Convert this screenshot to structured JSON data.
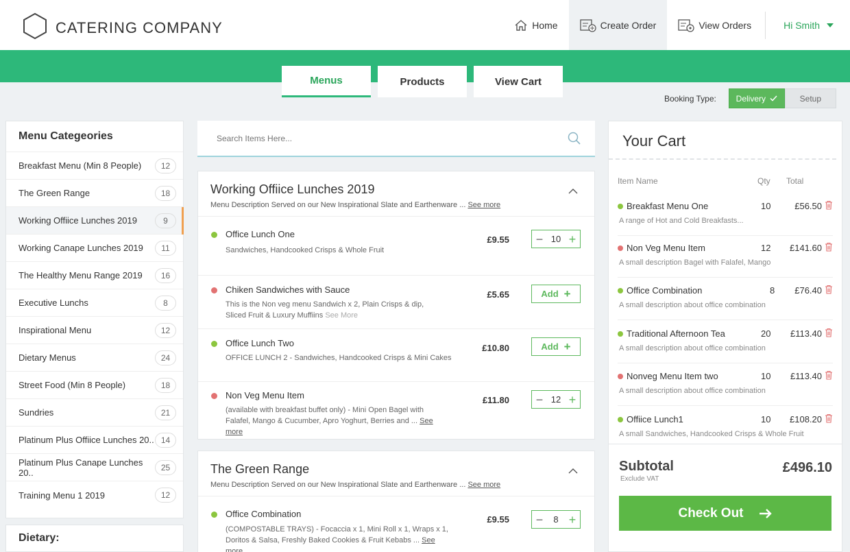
{
  "brand": {
    "name": "CATERING COMPANY"
  },
  "nav": {
    "home": "Home",
    "create_order": "Create Order",
    "view_orders": "View Orders",
    "user": "Hi Smith"
  },
  "tabs": [
    "Menus",
    "Products",
    "View Cart"
  ],
  "booking": {
    "label": "Booking Type:",
    "delivery": "Delivery",
    "setup": "Setup",
    "selected": "Delivery"
  },
  "sidebar": {
    "title": "Menu Categeories",
    "items": [
      {
        "label": "Breakfast Menu (Min 8 People)",
        "count": "12"
      },
      {
        "label": "The Green Range",
        "count": "18"
      },
      {
        "label": "Working Offiice Lunches 2019",
        "count": "9",
        "active": true
      },
      {
        "label": "Working Canape Lunches 2019",
        "count": "11"
      },
      {
        "label": "The Healthy Menu Range 2019",
        "count": "16"
      },
      {
        "label": "Executive Lunchs",
        "count": "8"
      },
      {
        "label": "Inspirational Menu",
        "count": "12"
      },
      {
        "label": "Dietary Menus",
        "count": "24"
      },
      {
        "label": "Street Food (Min 8 People)",
        "count": "18"
      },
      {
        "label": "Sundries",
        "count": "21"
      },
      {
        "label": "Platinum Plus Offiice Lunches 20..",
        "count": "14"
      },
      {
        "label": "Platinum Plus Canape Lunches 20..",
        "count": "25"
      },
      {
        "label": "Training Menu 1 2019",
        "count": "12"
      }
    ],
    "dietary_title": "Dietary:"
  },
  "search": {
    "placeholder": "Search Items Here..."
  },
  "sections": [
    {
      "title": "Working Offiice Lunches 2019",
      "desc": "Menu Description Served on our New Inspirational Slate and Earthenware",
      "see_more": "See more",
      "items": [
        {
          "name": "Office Lunch One",
          "desc1": "Sandwiches, Handcooked Crisps & Whole Fruit",
          "desc2": "",
          "inline_more": "",
          "price": "£9.55",
          "qty": "10",
          "type": "veg"
        },
        {
          "name": "Chiken Sandwiches with Sauce",
          "desc1": "This is the Non veg menu Sandwich x 2, Plain Crisps & dip,",
          "desc2": "Sliced Fruit & Luxury Muffiins",
          "inline_more": "See More",
          "price": "£5.65",
          "add": "Add",
          "type": "nonveg"
        },
        {
          "name": "Office Lunch Two",
          "desc1": "OFFICE LUNCH 2 - Sandwiches, Handcooked Crisps & Mini Cakes",
          "desc2": "",
          "inline_more": "",
          "price": "£10.80",
          "add": "Add",
          "type": "veg"
        },
        {
          "name": "Non Veg Menu Item",
          "desc1": "(available with breakfast buffet only) - Mini Open Bagel with",
          "desc2": "Falafel, Mango & Cucumber, Apro Yoghurt, Berries and ...",
          "inline_more": "See more",
          "price": "£11.80",
          "qty": "12",
          "type": "nonveg"
        }
      ]
    },
    {
      "title": "The Green Range",
      "desc": "Menu Description Served on our New Inspirational Slate and Earthenware",
      "see_more": "See more",
      "items": [
        {
          "name": "Office Combination",
          "desc1": "(COMPOSTABLE TRAYS) - Focaccia x 1, Mini Roll x 1, Wraps x 1,",
          "desc2": "Doritos & Salsa, Freshly Baked Cookies & Fruit Kebabs  ...",
          "inline_more": "See more",
          "price": "£9.55",
          "qty": "8",
          "type": "veg"
        }
      ]
    }
  ],
  "cart": {
    "title": "Your Cart",
    "col_name": "Item Name",
    "col_qty": "Qty",
    "col_total": "Total",
    "rows": [
      {
        "name": "Breakfast Menu One",
        "desc": "A range of Hot and Cold Breakfasts...",
        "qty": "10",
        "total": "£56.50",
        "type": "veg"
      },
      {
        "name": "Non Veg Menu Item",
        "desc": "A small description Bagel with Falafel, Mango",
        "qty": "12",
        "total": "£141.60",
        "type": "nonveg"
      },
      {
        "name": "Office Combination",
        "desc": "A small description about office combination",
        "qty": "8",
        "total": "£76.40",
        "type": "veg"
      },
      {
        "name": "Traditional Afternoon Tea",
        "desc": "A small description about office combination",
        "qty": "20",
        "total": "£113.40",
        "type": "veg"
      },
      {
        "name": "Nonveg Menu Item two",
        "desc": "A small description about office combination",
        "qty": "10",
        "total": "£113.40",
        "type": "nonveg"
      },
      {
        "name": "Offiice Lunch1",
        "desc": "A small Sandwiches, Handcooked Crisps & Whole Fruit",
        "qty": "10",
        "total": "£108.20",
        "type": "veg"
      }
    ],
    "subtotal_label": "Subtotal",
    "subtotal_note": "Exclude VAT",
    "subtotal_value": "£496.10",
    "checkout": "Check Out"
  },
  "colors": {
    "accent": "#2db87a",
    "veg": "#8cc63f",
    "nonveg": "#e27272",
    "cta": "#5cb846"
  }
}
